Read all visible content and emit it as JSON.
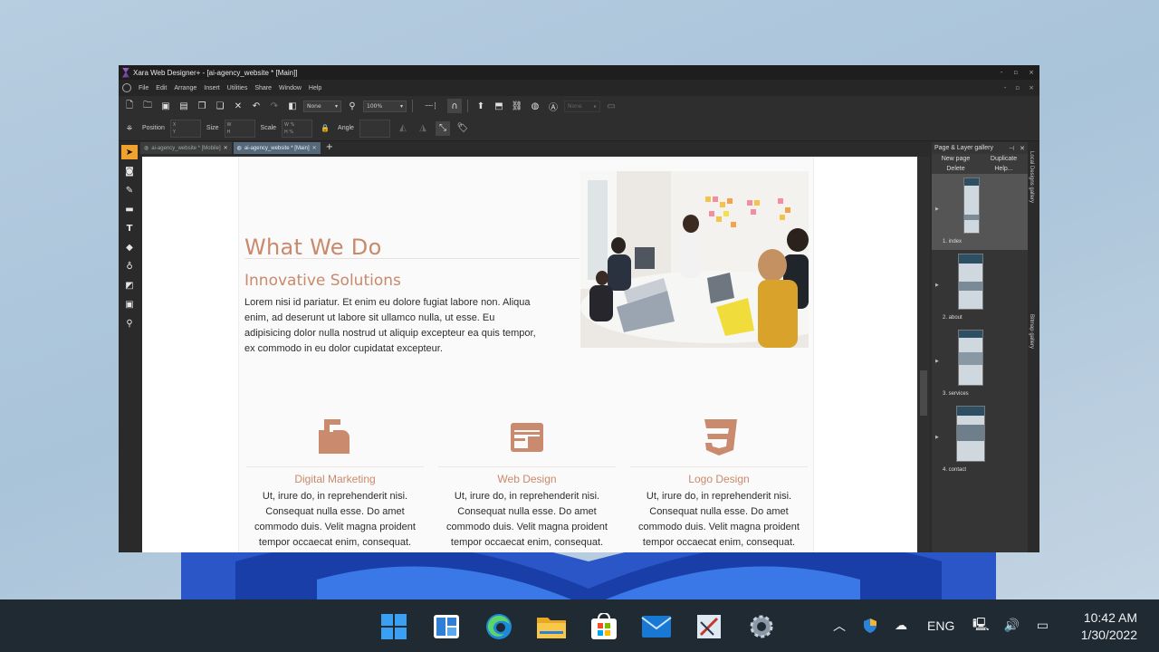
{
  "window": {
    "title": "Xara Web Designer+ - [ai-agency_website * [Main]]",
    "title_controls": [
      "-",
      "▫",
      "×"
    ],
    "menu": [
      "File",
      "Edit",
      "Arrange",
      "Insert",
      "Utilities",
      "Share",
      "Window",
      "Help"
    ]
  },
  "toolbar": {
    "blend_value": "None",
    "zoom_value": "100%",
    "none_value": "None"
  },
  "infobar": {
    "position_label": "Position",
    "size_label": "Size",
    "scale_label": "Scale",
    "angle_label": "Angle",
    "x": "X",
    "y": "Y",
    "w": "W",
    "h": "H",
    "pct": "%"
  },
  "tabs": [
    {
      "label": "ai-agency_website * [Mobile]",
      "active": false
    },
    {
      "label": "ai-agency_website * [Main]",
      "active": true
    }
  ],
  "tab_add": "+",
  "page": {
    "heading": "What We Do",
    "subheading": "Innovative Solutions",
    "body": "Lorem nisi id pariatur. Et enim eu dolore fugiat labore non. Aliqua enim, ad deserunt ut labore sit ullamco nulla, ut esse. Eu adipisicing dolor nulla nostrud ut aliquip excepteur ea quis tempor, ex commodo in eu dolor cupidatat excepteur.",
    "services": [
      {
        "title": "Digital Marketing",
        "icon": "mailbox-icon",
        "desc": "Ut, irure do, in reprehenderit nisi. Consequat nulla esse. Do amet commodo duis. Velit magna proident tempor occaecat enim, consequat."
      },
      {
        "title": "Web Design",
        "icon": "browser-window-icon",
        "desc": "Ut, irure do, in reprehenderit nisi. Consequat nulla esse. Do amet commodo duis. Velit magna proident tempor occaecat enim, consequat."
      },
      {
        "title": "Logo Design",
        "icon": "css3-icon",
        "desc": "Ut, irure do, in reprehenderit nisi. Consequat nulla esse. Do amet commodo duis. Velit magna proident tempor occaecat enim, consequat."
      }
    ]
  },
  "gallery": {
    "title": "Page & Layer gallery",
    "buttons": [
      "New page",
      "Duplicate",
      "Delete",
      "Help..."
    ],
    "pages": [
      "1. index",
      "2. about",
      "3. services",
      "4. contact"
    ],
    "side_tabs": [
      "Local Designs gallery",
      "Bitmap gallery"
    ]
  },
  "taskbar": {
    "language": "ENG",
    "time": "10:42 AM",
    "date": "1/30/2022"
  },
  "colors": {
    "accent": "#c9896a",
    "tool_active": "#f0a22e",
    "taskbar": "#1f2a33"
  }
}
